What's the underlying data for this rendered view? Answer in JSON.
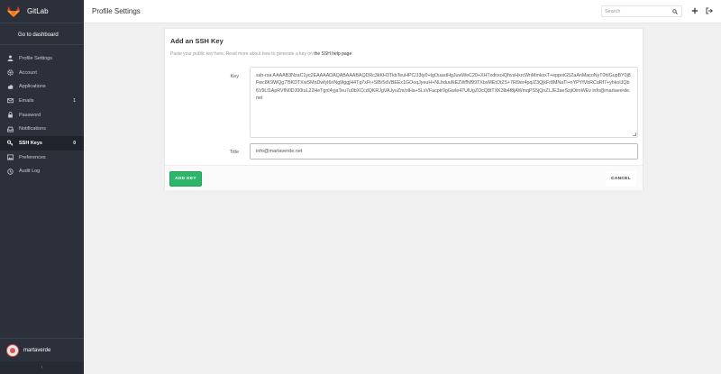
{
  "app": {
    "name": "GitLab",
    "go_to_dashboard": "Go to dashboard"
  },
  "sidebar": {
    "items": [
      {
        "label": "Profile Settings",
        "icon": "user-icon"
      },
      {
        "label": "Account",
        "icon": "gear-icon"
      },
      {
        "label": "Applications",
        "icon": "cloud-icon"
      },
      {
        "label": "Emails",
        "icon": "envelope-icon",
        "count": "1"
      },
      {
        "label": "Password",
        "icon": "lock-icon"
      },
      {
        "label": "Notifications",
        "icon": "inbox-icon"
      },
      {
        "label": "SSH Keys",
        "icon": "key-icon",
        "count": "0",
        "active": true
      },
      {
        "label": "Preferences",
        "icon": "image-icon"
      },
      {
        "label": "Audit Log",
        "icon": "history-icon"
      }
    ],
    "user": "martaverde",
    "collapse_icon": "angle-left-icon"
  },
  "header": {
    "title": "Profile Settings",
    "search_placeholder": "Search",
    "icons": [
      "search-icon",
      "plus-icon",
      "sign-out-icon"
    ]
  },
  "form": {
    "title": "Add an SSH Key",
    "desc_prefix": "Paste your public key here. Read more about how to generate a key on ",
    "desc_link": "the SSH help page",
    "key_label": "Key",
    "key_value": "ssh-rsa AAAAB3NzaC1yc2EAAAADAQABAAABAQDRc3kKH3TkbTeuHPC/J3ty0+tgOuastHgJuwWeC20+XHTxdnxoiQhvsHxrcWnMmksxT+eppoiG5ZaAnMacoNyT0hlGupBY0j8Fwc8K9WQg7'BKDTXwSMnDwfyl6riNg9lggjH4Tq7xFt+SlB/5dVBEEx1GOoqJyeuH+NLhduuNEZWfNf99TXbsMEtOt2S+7Rl9er4pq/Z3QjkFr8MNaTl+nYPYfVbRCaRf7+yhkoIJQb6V9Lf1ApRVfN0DJ00tuL22HeTgnI4yjaTeu7u0bXCcdQKRJgVAJyuZm/olHa+5LxVFacptr9gGwIe47UlUgZOcQ8tTXK3lb4f8jAWmqPS5jQnZLJE3aeSzjiOimWEv info@martaverde.net",
    "title_label": "Title",
    "title_value": "info@martaverde.net",
    "add_button": "ADD KEY",
    "cancel_button": "CANCEL"
  },
  "colors": {
    "sidebar": "#2b303b",
    "accent": "#2db56a",
    "logo": "#e2432a"
  }
}
